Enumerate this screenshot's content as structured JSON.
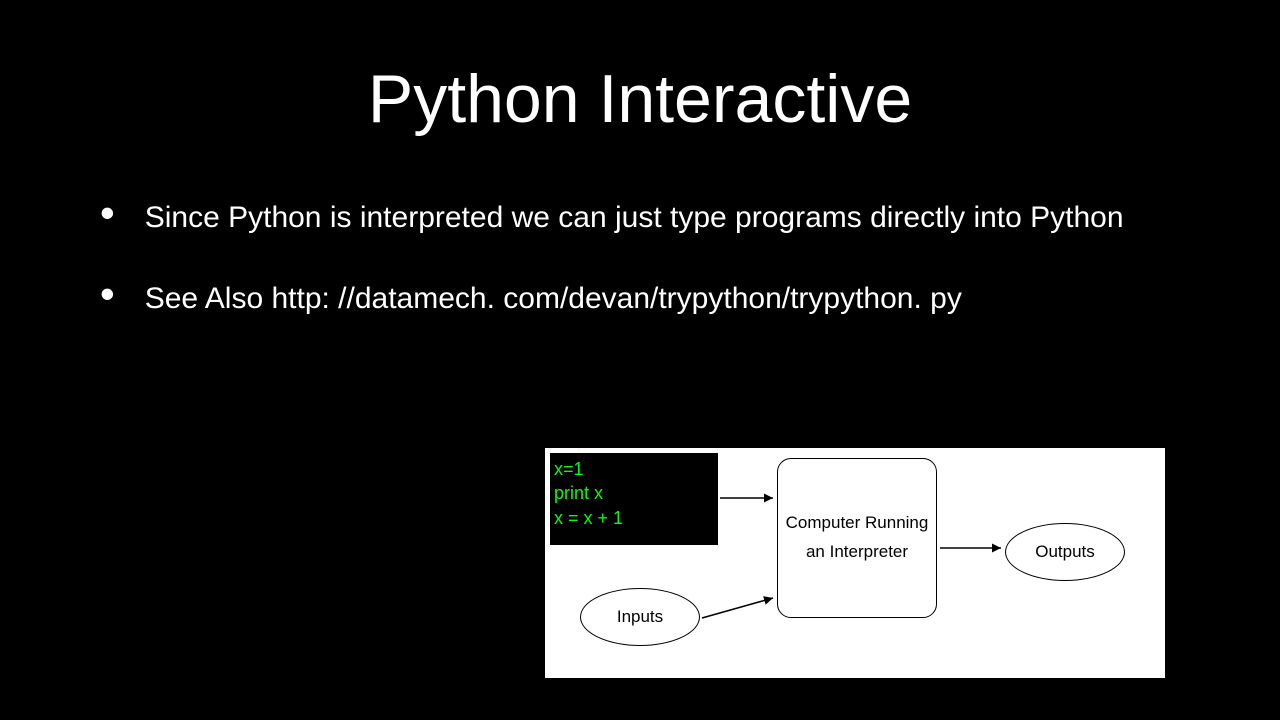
{
  "title": "Python Interactive",
  "bullets": [
    "Since Python is interpreted we can just type programs directly into Python",
    "See Also http: //datamech. com/devan/trypython/trypython. py"
  ],
  "diagram": {
    "code": "x=1\nprint x\nx = x + 1",
    "interpreter": "Computer Running an Interpreter",
    "inputs": "Inputs",
    "outputs": "Outputs"
  }
}
